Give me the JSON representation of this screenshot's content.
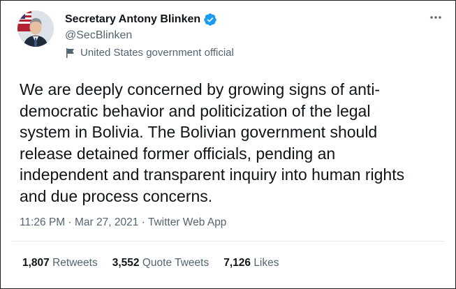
{
  "author": {
    "display_name": "Secretary Antony Blinken",
    "handle": "@SecBlinken",
    "label": "United States government official",
    "verified_icon": "verified-badge",
    "label_icon": "flag-icon"
  },
  "tweet": {
    "text": "We are deeply concerned by growing signs of anti-\ndemocratic behavior and politicization of the legal\nsystem in Bolivia. The Bolivian government should\nrelease detained former officials, pending an\nindependent and transparent inquiry into human rights\nand due process concerns.",
    "time": "11:26 PM",
    "date": "Mar 27, 2021",
    "source": "Twitter Web App",
    "separator": "·"
  },
  "stats": {
    "retweets_count": "1,807",
    "retweets_label": "Retweets",
    "quotes_count": "3,552",
    "quotes_label": "Quote Tweets",
    "likes_count": "7,126",
    "likes_label": "Likes"
  },
  "colors": {
    "text_primary": "#0f1419",
    "text_secondary": "#536471",
    "verified_blue": "#1d9bf0",
    "divider": "#e1e8ed",
    "frame_border": "#1f1f1f"
  }
}
